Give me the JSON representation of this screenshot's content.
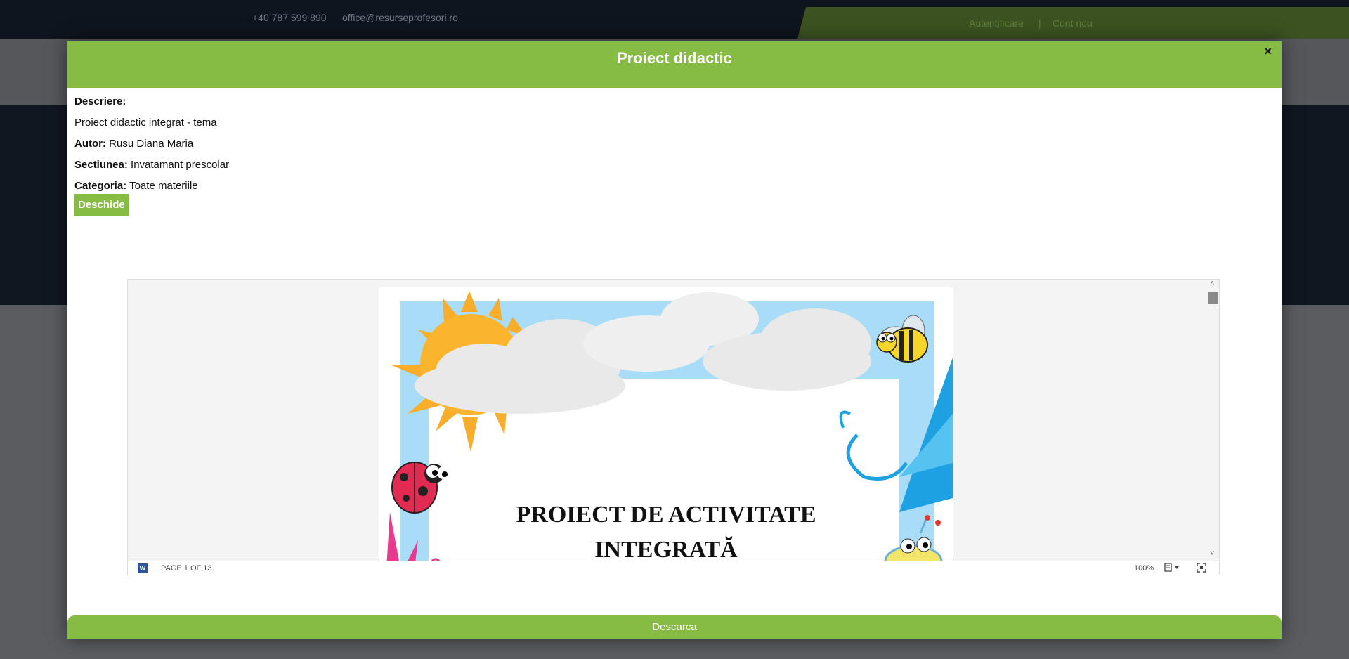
{
  "background": {
    "phone": "+40 787 599 890",
    "email": "office@resurseprofesori.ro",
    "login": "Autentificare",
    "separator": "|",
    "register": "Cont nou"
  },
  "modal": {
    "title": "Proiect didactic",
    "close_label": "×",
    "description_label": "Descriere:",
    "description_text": "Proiect didactic integrat - tema",
    "author_label": "Autor:",
    "author_value": "Rusu Diana Maria",
    "section_label": "Sectiunea:",
    "section_value": "Invatamant prescolar",
    "category_label": "Categoria:",
    "category_value": "Toate materiile",
    "open_button": "Deschide",
    "download_button": "Descarca"
  },
  "viewer": {
    "doc_title_line1": "PROIECT DE ACTIVITATE",
    "doc_title_line2": "INTEGRATĂ",
    "page_indicator": "PAGE 1 OF 13",
    "zoom": "100%",
    "scroll_up": "˄",
    "scroll_down": "˅",
    "app_icon": "word-icon",
    "view_menu_icon": "page-view-icon",
    "fullscreen_icon": "fullscreen-icon"
  },
  "colors": {
    "accent_green": "#86bc43",
    "dark_navy": "#0f151e"
  }
}
